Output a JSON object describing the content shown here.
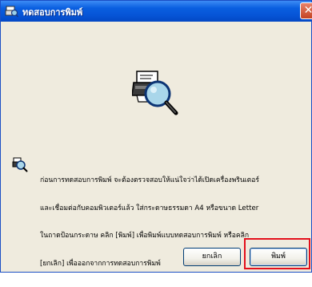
{
  "window": {
    "title": "ทดสอบการพิมพ์",
    "title_icon": "printer-test-icon",
    "close_label": "✕"
  },
  "dialog": {
    "hero_icon": "printer-magnifier-icon",
    "message_icon": "printer-magnifier-small-icon",
    "message_lines": [
      "ก่อนการทดสอบการพิมพ์ จะต้องตรวจสอบให้แน่ใจว่าได้เปิดเครื่องพรินเตอร์",
      "และเชื่อมต่อกับคอมพิวเตอร์แล้ว ใส่กระดาษธรรมดา A4 หรือขนาด Letter",
      "ในถาดป้อนกระดาษ คลิก [พิมพ์] เพื่อพิมพ์แบบทดสอบการพิมพ์ หรือคลิก",
      "[ยกเลิก] เพื่อออกจากการทดสอบการพิมพ์"
    ]
  },
  "buttons": {
    "cancel": "ยกเลิก",
    "print": "พิมพ์"
  },
  "colors": {
    "title_bar": "#0654d6",
    "dialog_bg": "#efebde",
    "highlight": "#e3101c"
  }
}
